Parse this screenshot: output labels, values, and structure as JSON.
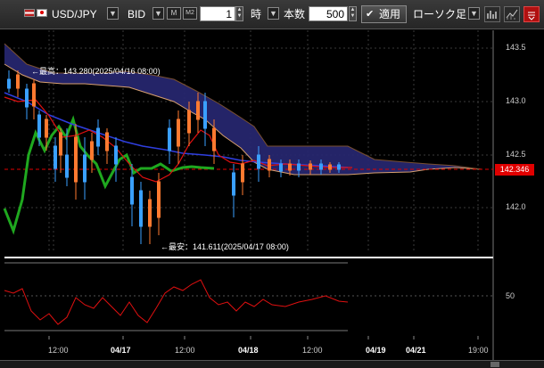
{
  "toolbar": {
    "symbol": "USD/JPY",
    "price_type": "BID",
    "m_label": "M",
    "m2_label": "M2",
    "interval_value": "1",
    "interval_unit": "時",
    "count_label": "本数",
    "count_value": "500",
    "apply_label": "適用",
    "candle_type": "ローソク足"
  },
  "price_axis": [
    "143.5",
    "143.0",
    "142.5",
    "142.0"
  ],
  "current_price": "142.346",
  "annotations": {
    "high": "←最高：143.280(2025/04/16 08:00)",
    "low": "←最安：141.611(2025/04/17 08:00)"
  },
  "oscillator_axis": [
    "50"
  ],
  "time_axis": [
    "12:00",
    "04/17",
    "12:00",
    "04/18",
    "12:00",
    "04/19",
    "04/21",
    "19:00"
  ],
  "colors": {
    "background": "#000000",
    "cloud": "#2c2c7a",
    "current_price": "#e00000",
    "up_candle": "#ff7a30",
    "down_candle": "#3aa0ff",
    "indicator_green": "#1fa81f",
    "indicator_red": "#e01010"
  }
}
